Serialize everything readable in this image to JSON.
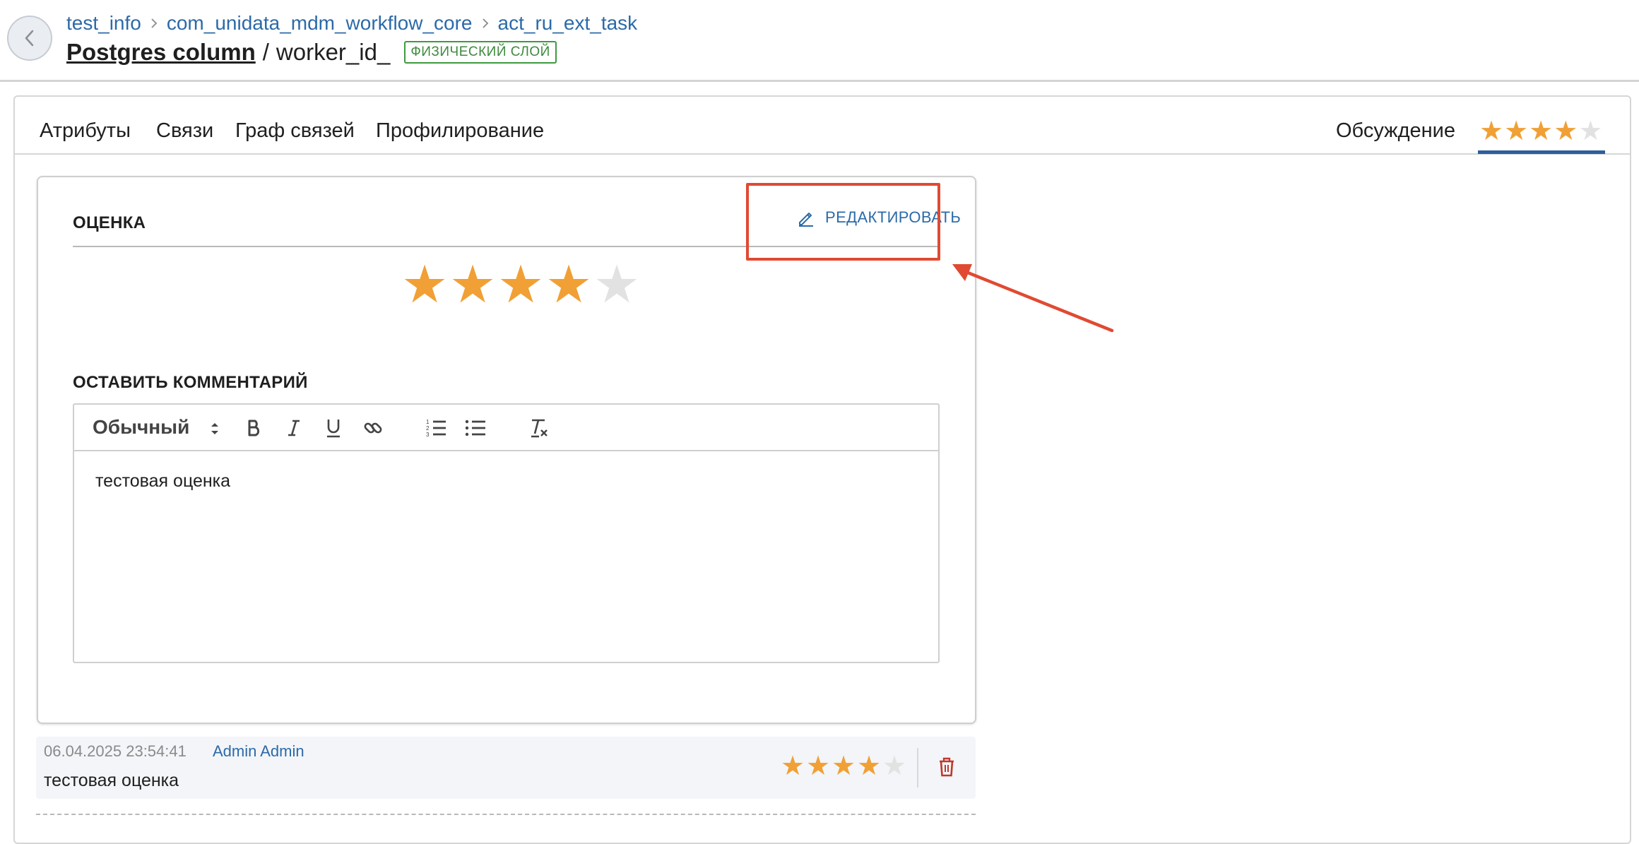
{
  "header": {
    "breadcrumb": [
      "test_info",
      "com_unidata_mdm_workflow_core",
      "act_ru_ext_task"
    ],
    "title_link": "Postgres column",
    "title_separator": "/",
    "title_name": "worker_id_",
    "layer_badge": "ФИЗИЧЕСКИЙ СЛОЙ"
  },
  "tabs": {
    "items": [
      "Атрибуты",
      "Связи",
      "Граф связей",
      "Профилирование"
    ],
    "discussion": "Обсуждение",
    "discussion_rating": 4,
    "max_rating": 5
  },
  "rating": {
    "section_title": "ОЦЕНКА",
    "edit_label": "РЕДАКТИРОВАТЬ",
    "value": 4
  },
  "comment_form": {
    "section_title": "ОСТАВИТЬ КОММЕНТАРИЙ",
    "format_select": "Обычный",
    "content": "тестовая оценка"
  },
  "comments": [
    {
      "date": "06.04.2025 23:54:41",
      "author": "Admin Admin",
      "text": "тестовая оценка",
      "rating": 4
    }
  ],
  "colors": {
    "accent": "#2c6aa8",
    "star_filled": "#f0a035",
    "star_empty": "#e2e2e2",
    "badge_green": "#3e9a3e",
    "annotation_red": "#e04a32",
    "delete_red": "#c0392b"
  },
  "icons": {
    "back": "chevron-left-icon",
    "edit": "pencil-icon",
    "delete": "trash-icon"
  }
}
